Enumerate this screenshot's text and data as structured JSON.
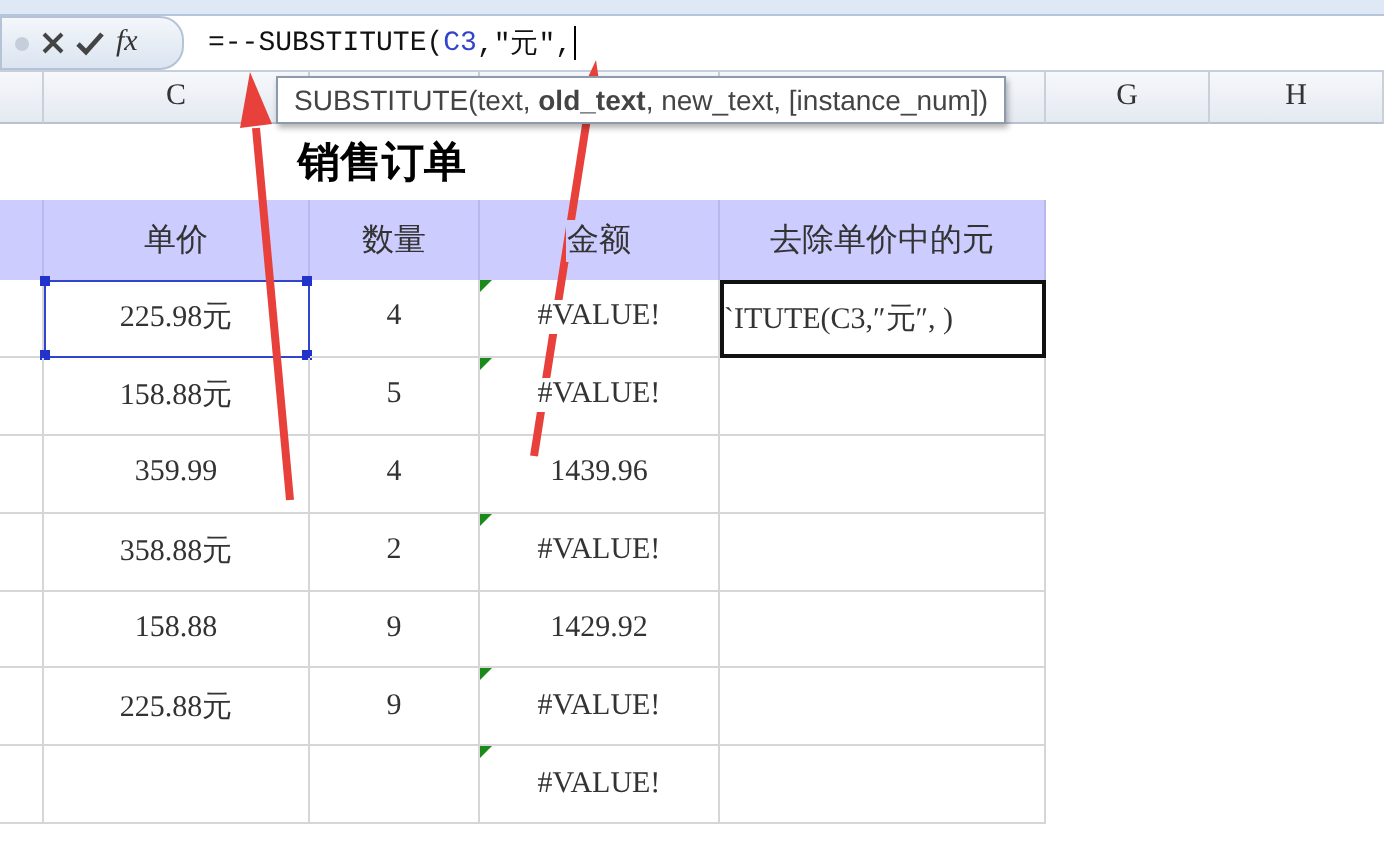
{
  "formula_bar": {
    "function_label": "fx",
    "formula_start": "=--SUBSTITUTE(",
    "formula_reference": "C3",
    "formula_end": ",″元″, "
  },
  "tooltip": "SUBSTITUTE(text, **old_text**, new_text, [instance_num])",
  "column_headers": [
    "C",
    "G",
    "H"
  ],
  "title": "销售订单",
  "table_headers": [
    "单价",
    "数量",
    "金额",
    "去除单价中的元"
  ],
  "rows": [
    {
      "price": "225.98元",
      "qty": "4",
      "amount": "#VALUE!",
      "error_flag": true,
      "selected": true,
      "edit_text": "`ITUTE(C3,″元″, )"
    },
    {
      "price": "158.88元",
      "qty": "5",
      "amount": "#VALUE!",
      "error_flag": true,
      "selected": false
    },
    {
      "price": "359.99",
      "qty": "4",
      "amount": "1439.96",
      "error_flag": false,
      "selected": false
    },
    {
      "price": "358.88元",
      "qty": "2",
      "amount": "#VALUE!",
      "error_flag": true,
      "selected": false
    },
    {
      "price": "158.88",
      "qty": "9",
      "amount": "1429.92",
      "error_flag": false,
      "selected": false
    },
    {
      "price": "225.88元",
      "qty": "9",
      "amount": "#VALUE!",
      "error_flag": true,
      "selected": false
    },
    {
      "qty": "",
      "amount": "#VALUE!",
      "error_flag": true,
      "selected": false
    }
  ]
}
